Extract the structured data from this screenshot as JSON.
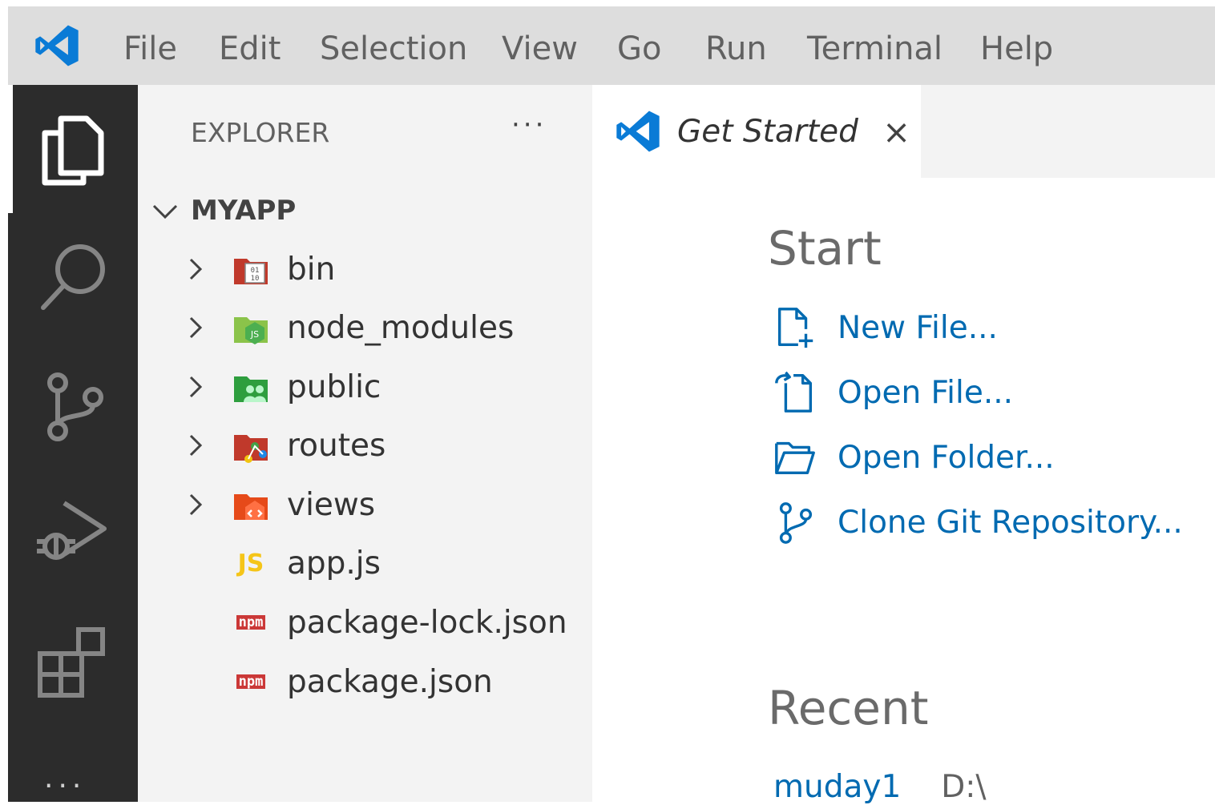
{
  "menu": {
    "items": [
      "File",
      "Edit",
      "Selection",
      "View",
      "Go",
      "Run",
      "Terminal",
      "Help"
    ]
  },
  "activity_bar": {
    "icons": [
      "explorer-icon",
      "search-icon",
      "source-control-icon",
      "run-debug-icon",
      "extensions-icon"
    ],
    "more": "···"
  },
  "sidebar": {
    "title": "EXPLORER",
    "more": "···",
    "root_folder": "MYAPP",
    "items": [
      {
        "name": "bin",
        "type": "folder",
        "icon": "bin-folder-icon"
      },
      {
        "name": "node_modules",
        "type": "folder",
        "icon": "node-folder-icon"
      },
      {
        "name": "public",
        "type": "folder",
        "icon": "public-folder-icon"
      },
      {
        "name": "routes",
        "type": "folder",
        "icon": "routes-folder-icon"
      },
      {
        "name": "views",
        "type": "folder",
        "icon": "views-folder-icon"
      },
      {
        "name": "app.js",
        "type": "file",
        "icon": "js-file-icon",
        "badge": "JS"
      },
      {
        "name": "package-lock.json",
        "type": "file",
        "icon": "npm-file-icon",
        "badge": "npm"
      },
      {
        "name": "package.json",
        "type": "file",
        "icon": "npm-file-icon",
        "badge": "npm"
      }
    ]
  },
  "editor": {
    "tab": {
      "label": "Get Started",
      "close": "×"
    },
    "start": {
      "title": "Start",
      "links": [
        {
          "label": "New File...",
          "icon": "new-file-icon"
        },
        {
          "label": "Open File...",
          "icon": "open-file-icon"
        },
        {
          "label": "Open Folder...",
          "icon": "open-folder-icon"
        },
        {
          "label": "Clone Git Repository...",
          "icon": "git-branch-icon"
        }
      ]
    },
    "recent": {
      "title": "Recent",
      "items": [
        {
          "name": "muday1",
          "path": "D:\\"
        }
      ]
    }
  },
  "colors": {
    "vscode_blue": "#007acc",
    "link": "#006ab1",
    "activity_bar": "#2c2c2c",
    "sidebar": "#f3f3f3",
    "titlebar": "#dddddd"
  }
}
